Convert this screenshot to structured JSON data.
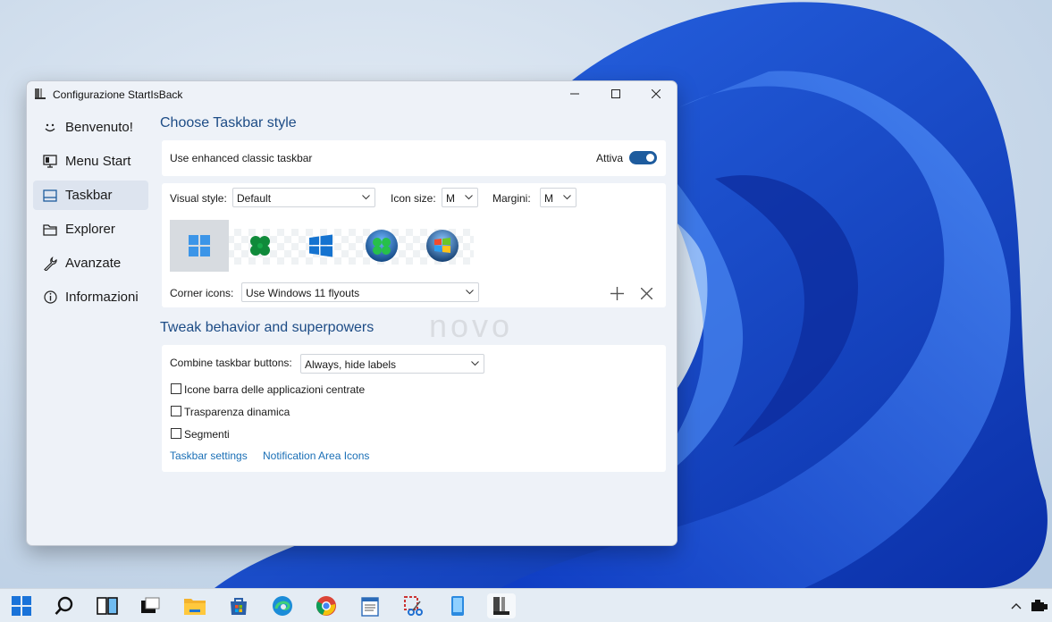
{
  "window": {
    "title": "Configurazione StartIsBack",
    "icon": "startisback-app-icon"
  },
  "sidebar": {
    "items": [
      {
        "label": "Benvenuto!",
        "icon": "smiley-icon"
      },
      {
        "label": "Menu Start",
        "icon": "monitor-icon"
      },
      {
        "label": "Taskbar",
        "icon": "taskbar-icon"
      },
      {
        "label": "Explorer",
        "icon": "folder-icon"
      },
      {
        "label": "Avanzate",
        "icon": "wrench-icon"
      },
      {
        "label": "Informazioni",
        "icon": "info-icon"
      }
    ],
    "active": "Taskbar"
  },
  "taskbar_style": {
    "heading": "Choose Taskbar style",
    "enhanced_label": "Use enhanced classic taskbar",
    "toggle_label": "Attiva",
    "toggle_on": true,
    "visual_style_label": "Visual style:",
    "visual_style_value": "Default",
    "icon_size_label": "Icon size:",
    "icon_size_value": "M",
    "margins_label": "Margini:",
    "margins_value": "M",
    "start_buttons": [
      "windows11-start-icon",
      "clover-start-icon",
      "windows10-start-icon",
      "clover-orb-start-icon",
      "windows7-orb-start-icon"
    ],
    "selected_start_button": 0,
    "corner_icons_label": "Corner icons:",
    "corner_icons_value": "Use Windows 11 flyouts"
  },
  "tweak": {
    "heading": "Tweak behavior and superpowers",
    "combine_label": "Combine taskbar buttons:",
    "combine_value": "Always, hide labels",
    "checkboxes": [
      {
        "label": "Icone barra delle applicazioni centrate",
        "checked": false
      },
      {
        "label": "Trasparenza dinamica",
        "checked": false
      },
      {
        "label": "Segmenti",
        "checked": false
      }
    ],
    "links": [
      "Taskbar settings",
      "Notification Area Icons"
    ]
  },
  "watermark": "novo",
  "os_taskbar": {
    "icons": [
      "start-icon",
      "search-icon",
      "task-view-icon",
      "widgets-icon",
      "file-explorer-icon",
      "store-icon",
      "edge-icon",
      "chrome-icon",
      "notepad-icon",
      "snipping-tool-icon",
      "phone-icon",
      "startisback-icon"
    ],
    "tray": [
      "chevron-up-icon",
      "network-icon"
    ]
  },
  "colors": {
    "accent": "#1e5c9e",
    "heading": "#1d4c86",
    "link": "#1a6fb6"
  }
}
